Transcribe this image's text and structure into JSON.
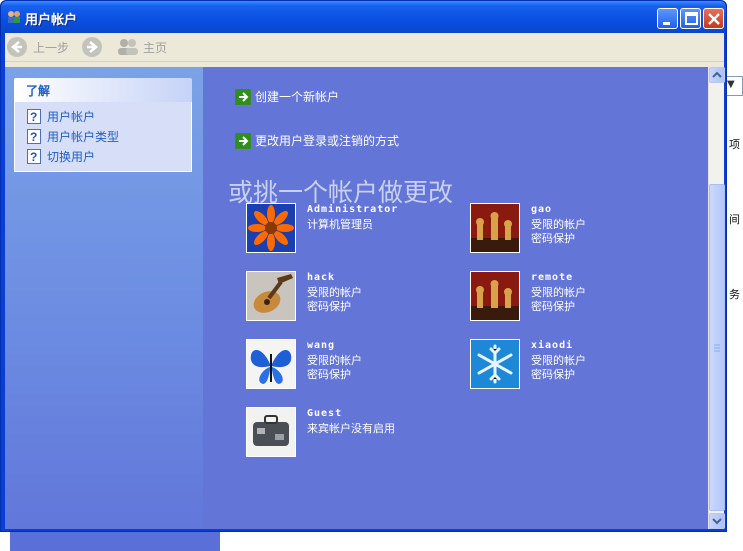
{
  "window": {
    "title": "用户帐户"
  },
  "toolbar": {
    "back_label": "上一步",
    "forward_label": "",
    "home_label": "主页"
  },
  "sidebar": {
    "section_title": "了解",
    "items": [
      {
        "label": "用户帐户",
        "icon": "help-icon"
      },
      {
        "label": "用户帐户类型",
        "icon": "help-icon"
      },
      {
        "label": "切换用户",
        "icon": "help-icon"
      }
    ]
  },
  "tasks": {
    "create_account": "创建一个新帐户",
    "change_logon": "更改用户登录或注销的方式"
  },
  "heading": "或挑一个帐户做更改",
  "accounts": [
    {
      "name": "Administrator",
      "line1": "计算机管理员",
      "line2": "",
      "picture": "flower"
    },
    {
      "name": "gao",
      "line1": "受限的帐户",
      "line2": "密码保护",
      "picture": "chess"
    },
    {
      "name": "hack",
      "line1": "受限的帐户",
      "line2": "密码保护",
      "picture": "guitar"
    },
    {
      "name": "remote",
      "line1": "受限的帐户",
      "line2": "密码保护",
      "picture": "chess"
    },
    {
      "name": "wang",
      "line1": "受限的帐户",
      "line2": "密码保护",
      "picture": "butterfly"
    },
    {
      "name": "xiaodi",
      "line1": "受限的帐户",
      "line2": "密码保护",
      "picture": "snowflake"
    },
    {
      "name": "Guest",
      "line1": "来宾帐户没有启用",
      "line2": "",
      "picture": "suitcase"
    }
  ],
  "background_glyphs": [
    "项",
    "间",
    "务"
  ]
}
